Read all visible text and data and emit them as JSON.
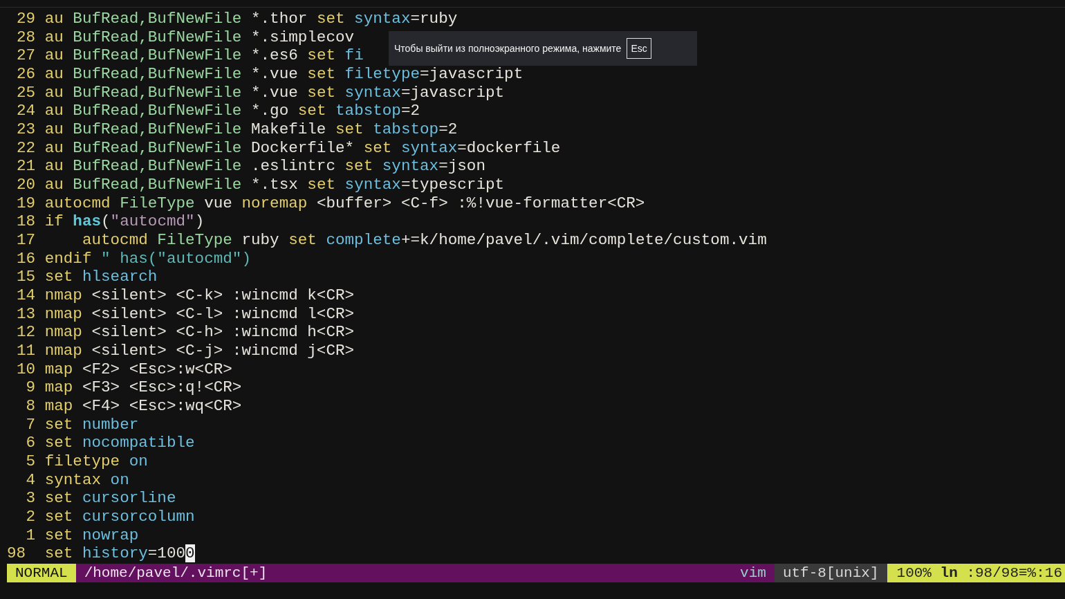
{
  "editor": {
    "lines": [
      {
        "number": "29",
        "current": false,
        "segments": [
          {
            "kind": "keyword",
            "text": "au"
          },
          {
            "kind": "type",
            "text": " BufRead,BufNewFile"
          },
          {
            "kind": "plain",
            "text": " *.thor "
          },
          {
            "kind": "keyword",
            "text": "set"
          },
          {
            "kind": "option",
            "text": " syntax"
          },
          {
            "kind": "plain",
            "text": "=ruby"
          }
        ]
      },
      {
        "number": "28",
        "current": false,
        "segments": [
          {
            "kind": "keyword",
            "text": "au"
          },
          {
            "kind": "type",
            "text": " BufRead,BufNewFile"
          },
          {
            "kind": "plain",
            "text": " *.simplecov"
          }
        ]
      },
      {
        "number": "27",
        "current": false,
        "segments": [
          {
            "kind": "keyword",
            "text": "au"
          },
          {
            "kind": "type",
            "text": " BufRead,BufNewFile"
          },
          {
            "kind": "plain",
            "text": " *.es6 "
          },
          {
            "kind": "keyword",
            "text": "set"
          },
          {
            "kind": "option",
            "text": " fi"
          }
        ]
      },
      {
        "number": "26",
        "current": false,
        "segments": [
          {
            "kind": "keyword",
            "text": "au"
          },
          {
            "kind": "type",
            "text": " BufRead,BufNewFile"
          },
          {
            "kind": "plain",
            "text": " *.vue "
          },
          {
            "kind": "keyword",
            "text": "set"
          },
          {
            "kind": "option",
            "text": " filetype"
          },
          {
            "kind": "plain",
            "text": "=javascript"
          }
        ]
      },
      {
        "number": "25",
        "current": false,
        "segments": [
          {
            "kind": "keyword",
            "text": "au"
          },
          {
            "kind": "type",
            "text": " BufRead,BufNewFile"
          },
          {
            "kind": "plain",
            "text": " *.vue "
          },
          {
            "kind": "keyword",
            "text": "set"
          },
          {
            "kind": "option",
            "text": " syntax"
          },
          {
            "kind": "plain",
            "text": "=javascript"
          }
        ]
      },
      {
        "number": "24",
        "current": false,
        "segments": [
          {
            "kind": "keyword",
            "text": "au"
          },
          {
            "kind": "type",
            "text": " BufRead,BufNewFile"
          },
          {
            "kind": "plain",
            "text": " *.go "
          },
          {
            "kind": "keyword",
            "text": "set"
          },
          {
            "kind": "option",
            "text": " tabstop"
          },
          {
            "kind": "plain",
            "text": "=2"
          }
        ]
      },
      {
        "number": "23",
        "current": false,
        "segments": [
          {
            "kind": "keyword",
            "text": "au"
          },
          {
            "kind": "type",
            "text": " BufRead,BufNewFile"
          },
          {
            "kind": "plain",
            "text": " Makefile "
          },
          {
            "kind": "keyword",
            "text": "set"
          },
          {
            "kind": "option",
            "text": " tabstop"
          },
          {
            "kind": "plain",
            "text": "=2"
          }
        ]
      },
      {
        "number": "22",
        "current": false,
        "segments": [
          {
            "kind": "keyword",
            "text": "au"
          },
          {
            "kind": "type",
            "text": " BufRead,BufNewFile"
          },
          {
            "kind": "plain",
            "text": " Dockerfile* "
          },
          {
            "kind": "keyword",
            "text": "set"
          },
          {
            "kind": "option",
            "text": " syntax"
          },
          {
            "kind": "plain",
            "text": "=dockerfile"
          }
        ]
      },
      {
        "number": "21",
        "current": false,
        "segments": [
          {
            "kind": "keyword",
            "text": "au"
          },
          {
            "kind": "type",
            "text": " BufRead,BufNewFile"
          },
          {
            "kind": "plain",
            "text": " .eslintrc "
          },
          {
            "kind": "keyword",
            "text": "set"
          },
          {
            "kind": "option",
            "text": " syntax"
          },
          {
            "kind": "plain",
            "text": "=json"
          }
        ]
      },
      {
        "number": "20",
        "current": false,
        "segments": [
          {
            "kind": "keyword",
            "text": "au"
          },
          {
            "kind": "type",
            "text": " BufRead,BufNewFile"
          },
          {
            "kind": "plain",
            "text": " *.tsx "
          },
          {
            "kind": "keyword",
            "text": "set"
          },
          {
            "kind": "option",
            "text": " syntax"
          },
          {
            "kind": "plain",
            "text": "=typescript"
          }
        ]
      },
      {
        "number": "19",
        "current": false,
        "segments": [
          {
            "kind": "keyword",
            "text": "autocmd"
          },
          {
            "kind": "type",
            "text": " FileType"
          },
          {
            "kind": "plain",
            "text": " vue "
          },
          {
            "kind": "keyword",
            "text": "noremap"
          },
          {
            "kind": "plain",
            "text": " <buffer> <C-f> :%!vue-formatter<CR>"
          }
        ]
      },
      {
        "number": "18",
        "current": false,
        "segments": [
          {
            "kind": "keyword",
            "text": "if "
          },
          {
            "kind": "function",
            "text": "has"
          },
          {
            "kind": "plain",
            "text": "("
          },
          {
            "kind": "string",
            "text": "\"autocmd\""
          },
          {
            "kind": "plain",
            "text": ")"
          }
        ]
      },
      {
        "number": "17",
        "current": false,
        "segments": [
          {
            "kind": "keyword",
            "text": "    autocmd"
          },
          {
            "kind": "type",
            "text": " FileType"
          },
          {
            "kind": "plain",
            "text": " ruby "
          },
          {
            "kind": "keyword",
            "text": "set"
          },
          {
            "kind": "option",
            "text": " complete"
          },
          {
            "kind": "plain",
            "text": "+=k/home/pavel/.vim/complete/custom.vim"
          }
        ]
      },
      {
        "number": "16",
        "current": false,
        "segments": [
          {
            "kind": "keyword",
            "text": "endif"
          },
          {
            "kind": "comment",
            "text": " \" has(\"autocmd\")"
          }
        ]
      },
      {
        "number": "15",
        "current": false,
        "segments": [
          {
            "kind": "keyword",
            "text": "set"
          },
          {
            "kind": "option",
            "text": " hlsearch"
          }
        ]
      },
      {
        "number": "14",
        "current": false,
        "segments": [
          {
            "kind": "keyword",
            "text": "nmap"
          },
          {
            "kind": "plain",
            "text": " <silent> <C-k> :wincmd k<CR>"
          }
        ]
      },
      {
        "number": "13",
        "current": false,
        "segments": [
          {
            "kind": "keyword",
            "text": "nmap"
          },
          {
            "kind": "plain",
            "text": " <silent> <C-l> :wincmd l<CR>"
          }
        ]
      },
      {
        "number": "12",
        "current": false,
        "segments": [
          {
            "kind": "keyword",
            "text": "nmap"
          },
          {
            "kind": "plain",
            "text": " <silent> <C-h> :wincmd h<CR>"
          }
        ]
      },
      {
        "number": "11",
        "current": false,
        "segments": [
          {
            "kind": "keyword",
            "text": "nmap"
          },
          {
            "kind": "plain",
            "text": " <silent> <C-j> :wincmd j<CR>"
          }
        ]
      },
      {
        "number": "10",
        "current": false,
        "segments": [
          {
            "kind": "keyword",
            "text": "map"
          },
          {
            "kind": "plain",
            "text": " <F2> <Esc>:w<CR>"
          }
        ]
      },
      {
        "number": "9",
        "current": false,
        "segments": [
          {
            "kind": "keyword",
            "text": "map"
          },
          {
            "kind": "plain",
            "text": " <F3> <Esc>:q!<CR>"
          }
        ]
      },
      {
        "number": "8",
        "current": false,
        "segments": [
          {
            "kind": "keyword",
            "text": "map"
          },
          {
            "kind": "plain",
            "text": " <F4> <Esc>:wq<CR>"
          }
        ]
      },
      {
        "number": "7",
        "current": false,
        "segments": [
          {
            "kind": "keyword",
            "text": "set"
          },
          {
            "kind": "option",
            "text": " number"
          }
        ]
      },
      {
        "number": "6",
        "current": false,
        "segments": [
          {
            "kind": "keyword",
            "text": "set"
          },
          {
            "kind": "option",
            "text": " nocompatible"
          }
        ]
      },
      {
        "number": "5",
        "current": false,
        "segments": [
          {
            "kind": "keyword",
            "text": "filetype"
          },
          {
            "kind": "option",
            "text": " on"
          }
        ]
      },
      {
        "number": "4",
        "current": false,
        "segments": [
          {
            "kind": "keyword",
            "text": "syntax"
          },
          {
            "kind": "option",
            "text": " on"
          }
        ]
      },
      {
        "number": "3",
        "current": false,
        "segments": [
          {
            "kind": "keyword",
            "text": "set"
          },
          {
            "kind": "option",
            "text": " cursorline"
          }
        ]
      },
      {
        "number": "2",
        "current": false,
        "segments": [
          {
            "kind": "keyword",
            "text": "set"
          },
          {
            "kind": "option",
            "text": " cursorcolumn"
          }
        ]
      },
      {
        "number": "1",
        "current": false,
        "segments": [
          {
            "kind": "keyword",
            "text": "set"
          },
          {
            "kind": "option",
            "text": " nowrap"
          }
        ]
      },
      {
        "number": "98",
        "current": true,
        "segments": [
          {
            "kind": "keyword",
            "text": "set"
          },
          {
            "kind": "option",
            "text": " history"
          },
          {
            "kind": "plain",
            "text": "=100"
          },
          {
            "kind": "cursor",
            "text": "0"
          }
        ]
      }
    ]
  },
  "status_bar": {
    "mode": "NORMAL",
    "file": "/home/pavel/.vimrc[+]",
    "filetype": "vim",
    "encoding": "utf-8[unix]",
    "percent": "100%",
    "line_label": "ln",
    "position": ":98/98≡%:16"
  },
  "fullscreen_notice": {
    "message": "Чтобы выйти из полноэкранного режима, нажмите",
    "key": "Esc"
  }
}
